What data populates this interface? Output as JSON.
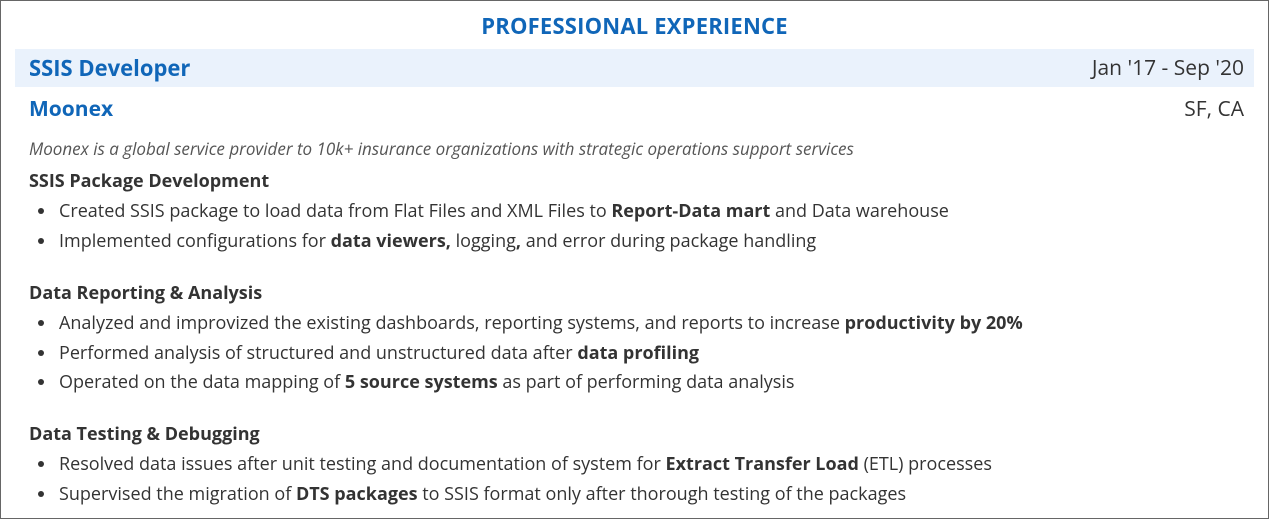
{
  "section_title": "PROFESSIONAL EXPERIENCE",
  "role": {
    "title": "SSIS Developer",
    "dates": "Jan '17 - Sep '20"
  },
  "company": {
    "name": "Moonex",
    "location": "SF, CA",
    "description": "Moonex is a global service provider to 10k+ insurance organizations with strategic operations support services"
  },
  "groups": {
    "g1": {
      "heading": "SSIS Package Development",
      "b1": {
        "p1": "Created SSIS package to load data from Flat Files and XML Files to ",
        "b1": "Report-Data mart",
        "p2": " and Data warehouse"
      },
      "b2": {
        "p1": "Implemented configurations for ",
        "b1": "data viewers,",
        "p2": " logging",
        "b2": ",",
        "p3": " and error during package handling"
      }
    },
    "g2": {
      "heading": "Data Reporting & Analysis",
      "b1": {
        "p1": "Analyzed and improvized the existing dashboards, reporting systems, and reports to increase ",
        "b1": "productivity by 20%"
      },
      "b2": {
        "p1": "Performed analysis of structured and unstructured data after ",
        "b1": "data profiling"
      },
      "b3": {
        "p1": "Operated on the data mapping of ",
        "b1": "5 source systems",
        "p2": " as part of performing data analysis"
      }
    },
    "g3": {
      "heading": "Data Testing & Debugging",
      "b1": {
        "p1": "Resolved data issues after unit testing and documentation of system for ",
        "b1": "Extract Transfer Load",
        "p2": " (ETL) processes"
      },
      "b2": {
        "p1": "Supervised the migration of ",
        "b1": "DTS packages",
        "p2": " to SSIS format only after thorough testing of the packages"
      }
    }
  }
}
